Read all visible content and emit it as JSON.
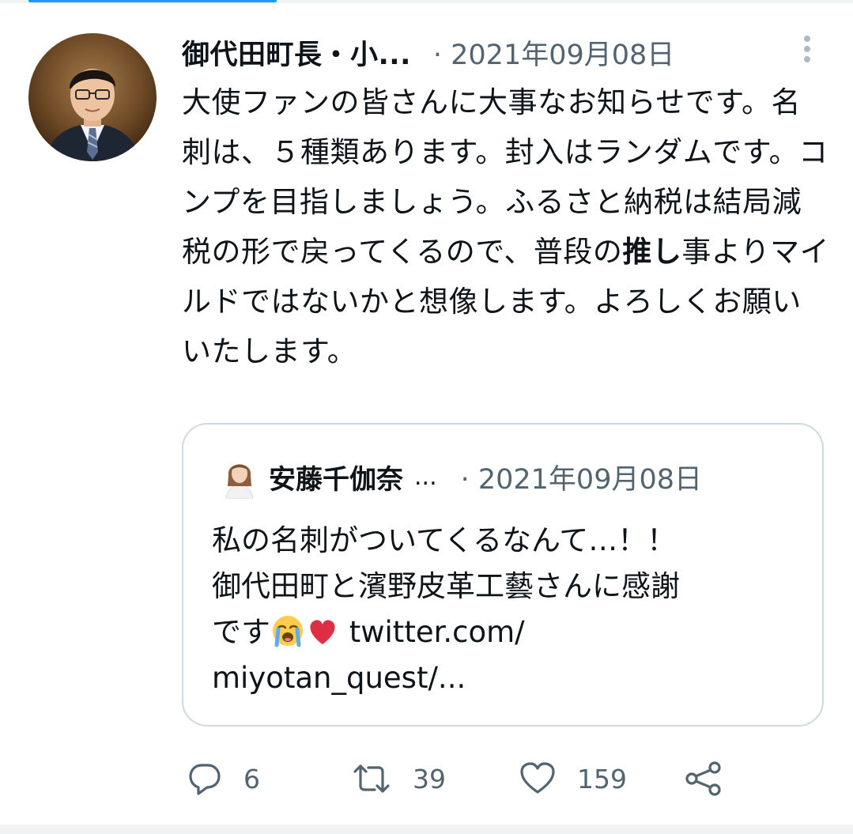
{
  "tweet": {
    "author_name": "御代田町長・小...",
    "date": "· 2021年09月08日",
    "text_part1": "大使ファンの皆さんに大事なお知らせです。名刺は、５種類あります。封入はランダムです。コンプを目指しましょう。ふるさと納税は結局減税の形で戻ってくるので、普段の",
    "text_bold": "推し",
    "text_part2": "事よりマイルドではないかと想像します。よろしくお願いいたします。"
  },
  "quote": {
    "author_name": "安藤千伽奈",
    "ellipsis": "...",
    "date": "· 2021年09月08日",
    "line1": "私の名刺がついてくるなんて…！！",
    "line2": "御代田町と濱野皮革工藝さんに感謝",
    "line3_start": "です",
    "line3_link": " twitter.com/",
    "line4": "miyotan_quest/..."
  },
  "actions": {
    "reply_count": "6",
    "retweet_count": "39",
    "like_count": "159"
  },
  "icons": {
    "more": "more-vertical-icon",
    "reply": "reply-icon",
    "retweet": "retweet-icon",
    "like": "heart-icon",
    "share": "share-icon",
    "emoji1": "loudly-crying-face",
    "emoji2": "red-heart"
  },
  "colors": {
    "text": "#0f1419",
    "secondary": "#536471",
    "border": "#cfd9de",
    "accent": "#1d9bf0"
  }
}
